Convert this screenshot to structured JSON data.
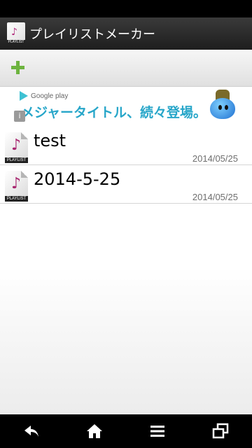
{
  "app": {
    "title": "プレイリストメーカー",
    "icon_caption": "PLAYLIST"
  },
  "toolbar": {
    "add_icon": "plus-icon",
    "accent_color": "#6db33f"
  },
  "ad": {
    "brand": "Google play",
    "headline": "メジャータイトル、続々登場。",
    "info_glyph": "i"
  },
  "playlists": [
    {
      "name": "test",
      "date": "2014/05/25",
      "icon_caption": "PLAYLIST"
    },
    {
      "name": "2014-5-25",
      "date": "2014/05/25",
      "icon_caption": "PLAYLIST"
    }
  ],
  "navbar": {
    "buttons": [
      "back-icon",
      "home-icon",
      "menu-icon",
      "recent-apps-icon"
    ]
  }
}
